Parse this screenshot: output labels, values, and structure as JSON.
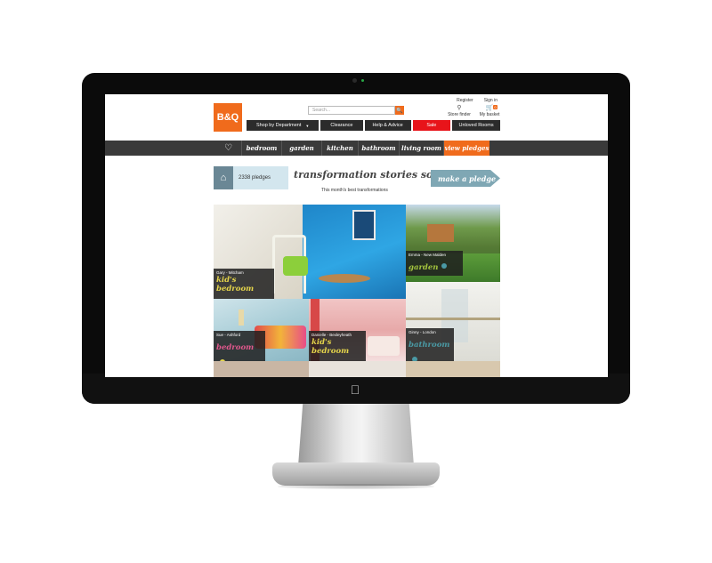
{
  "header": {
    "register": "Register",
    "sign_in": "Sign in",
    "logo": "B&Q",
    "search_placeholder": "Search...",
    "store_finder": "Store finder",
    "basket": "My basket",
    "basket_count": "0"
  },
  "menu": {
    "items": [
      "Shop by Department",
      "Clearance",
      "Help & Advice",
      "Sale",
      "Unloved Rooms"
    ]
  },
  "categories": {
    "items": [
      "bedroom",
      "garden",
      "kitchen",
      "bathroom",
      "living room",
      "view pledges"
    ]
  },
  "pledges": {
    "count_text": "2338 pledges",
    "title": "transformation stories so far",
    "subtitle": "This month's best transformations",
    "button": "make a pledge"
  },
  "tiles": [
    {
      "name": "Gary - Mitcham",
      "category": "kid's bedroom",
      "cat_color": "#e5d54b"
    },
    {
      "name": "Emma - New Malden",
      "category": "garden",
      "cat_color": "#a3c43e"
    },
    {
      "name": "Sue - Ashford",
      "category": "bedroom",
      "cat_color": "#e1588d"
    },
    {
      "name": "Danielle - Bexleyheath",
      "category": "kid's bedroom",
      "cat_color": "#e5d54b"
    },
    {
      "name": "Ginny - London",
      "category": "bathroom",
      "cat_color": "#4a9aa5"
    }
  ],
  "colors": {
    "brand_orange": "#f06b1c",
    "sale_red": "#e8141a",
    "nav_dark": "#3a3a3a"
  }
}
